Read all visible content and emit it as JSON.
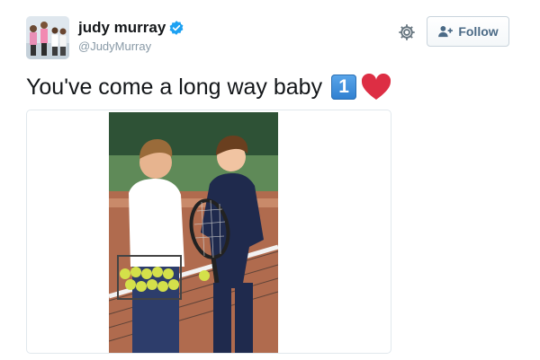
{
  "user": {
    "display_name": "judy murray",
    "handle": "@JudyMurray",
    "verified": true,
    "avatar_icon": "profile-photo"
  },
  "actions": {
    "follow_label": "Follow",
    "follow_icon": "add-user-icon",
    "settings_icon": "gear-icon"
  },
  "tweet": {
    "text": "You've come a long way baby",
    "emoji_number": "1",
    "emoji_heart": "red-heart"
  },
  "media": {
    "type": "photo",
    "subject_icon": "tennis-photo"
  },
  "colors": {
    "verified_blue": "#1da1f2",
    "follow_text": "#4b6a86",
    "handle_gray": "#8899a6",
    "heart_red": "#dd2e44"
  }
}
